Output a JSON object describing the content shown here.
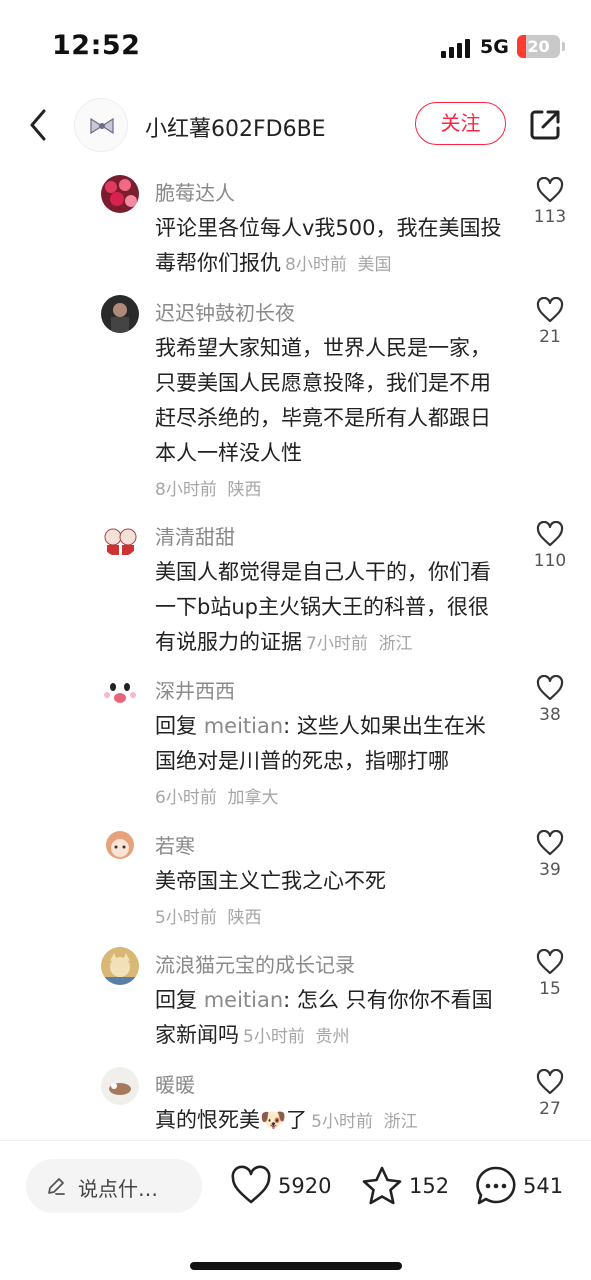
{
  "status_bar": {
    "time": "12:52",
    "network": "5G",
    "battery": "20",
    "battery_level": 0.2
  },
  "header": {
    "title": "小红薯602FD6BE",
    "follow_label": "关注"
  },
  "comments": [
    {
      "name": "脆莓达人",
      "text": "评论里各位每人v我500，我在美国投毒帮你们报仇",
      "time": "8小时前",
      "location": "美国",
      "likes": "113"
    },
    {
      "name": "迟迟钟鼓初长夜",
      "text": "我希望大家知道，世界人民是一家，只要美国人民愿意投降，我们是不用赶尽杀绝的，毕竟不是所有人都跟日本人一样没人性",
      "time": "8小时前",
      "location": "陕西",
      "likes": "21"
    },
    {
      "name": "清清甜甜",
      "text": "美国人都觉得是自己人干的，你们看一下b站up主火锅大王的科普，很很有说服力的证据",
      "time": "7小时前",
      "location": "浙江",
      "likes": "110"
    },
    {
      "name": "深井西西",
      "reply_prefix": "回复",
      "reply_to": "meitian",
      "text": "这些人如果出生在米国绝对是川普的死忠，指哪打哪",
      "time": "6小时前",
      "location": "加拿大",
      "likes": "38"
    },
    {
      "name": "若寒",
      "text": "美帝国主义亡我之心不死",
      "time": "5小时前",
      "location": "陕西",
      "likes": "39"
    },
    {
      "name": "流浪猫元宝的成长记录",
      "reply_prefix": "回复",
      "reply_to": "meitian",
      "text": "怎么 只有你你不看国家新闻吗",
      "time": "5小时前",
      "location": "贵州",
      "likes": "15"
    },
    {
      "name": "暖暖",
      "text": "真的恨死美",
      "text_after": "了",
      "emoji": "🐶",
      "time": "5小时前",
      "location": "浙江",
      "likes": "27"
    }
  ],
  "bottom_bar": {
    "input_placeholder": "说点什…",
    "likes": "5920",
    "collects": "152",
    "comments": "541"
  },
  "icons": {
    "back": "chevron-left-icon",
    "share": "share-icon",
    "like": "heart-icon",
    "collect": "star-icon",
    "comment": "chat-bubble-icon",
    "edit": "pencil-icon"
  },
  "colors": {
    "accent": "#ff2442",
    "muted_text": "#8a8a8a",
    "meta_text": "#a6a6a6"
  }
}
